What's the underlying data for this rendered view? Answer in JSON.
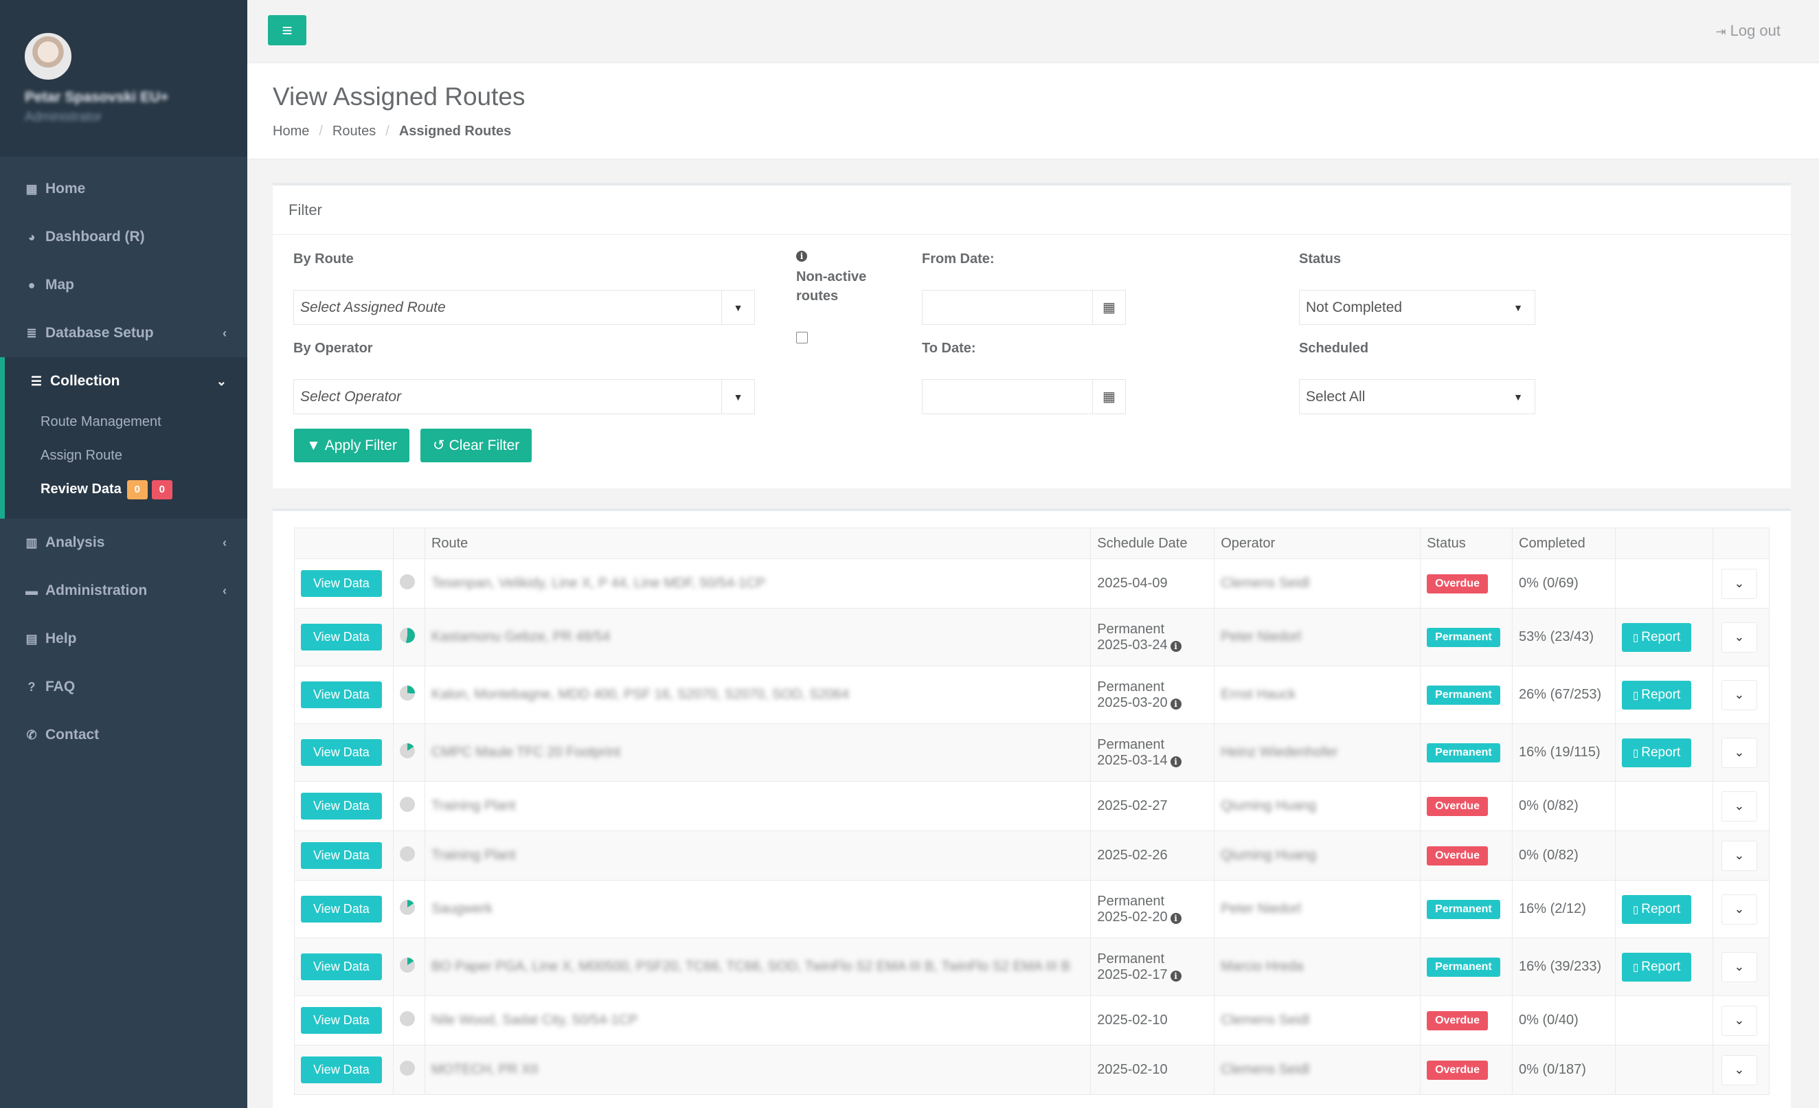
{
  "profile": {
    "name": "Petar Spasovski EU+",
    "role": "Administrator"
  },
  "nav": {
    "home": "Home",
    "dashboard": "Dashboard (R)",
    "map": "Map",
    "database_setup": "Database Setup",
    "collection": "Collection",
    "route_management": "Route Management",
    "assign_route": "Assign Route",
    "review_data": "Review Data",
    "review_badge_warn": "0",
    "review_badge_danger": "0",
    "analysis": "Analysis",
    "administration": "Administration",
    "help": "Help",
    "faq": "FAQ",
    "contact": "Contact"
  },
  "topbar": {
    "logout": "Log out"
  },
  "page": {
    "title": "View Assigned Routes",
    "breadcrumb": [
      "Home",
      "Routes",
      "Assigned Routes"
    ]
  },
  "filter": {
    "title": "Filter",
    "by_route_label": "By Route",
    "route_placeholder": "Select Assigned Route",
    "by_operator_label": "By Operator",
    "operator_placeholder": "Select Operator",
    "nonactive_label_1": "Non-active",
    "nonactive_label_2": "routes",
    "from_date_label": "From Date:",
    "to_date_label": "To Date:",
    "status_label": "Status",
    "status_value": "Not Completed",
    "scheduled_label": "Scheduled",
    "scheduled_value": "Select All",
    "apply": "Apply Filter",
    "clear": "Clear Filter"
  },
  "table": {
    "headers": [
      "",
      "",
      "Route",
      "Schedule Date",
      "Operator",
      "Status",
      "Completed",
      "",
      ""
    ],
    "view_label": "View Data",
    "report_label": "Report",
    "rows": [
      {
        "route": "Tesenpan, Velikidy, Line X, P 44, Line MDF, 50/54-1CP",
        "sched1": "",
        "sched2": "2025-04-09",
        "info": false,
        "operator": "Clemens Seidl",
        "status": "Overdue",
        "completed": "0% (0/69)",
        "report": false,
        "pct": 0
      },
      {
        "route": "Kastamonu Gebze, PR 48/54",
        "sched1": "Permanent",
        "sched2": "2025-03-24",
        "info": true,
        "operator": "Peter Niedorl",
        "status": "Permanent",
        "completed": "53% (23/43)",
        "report": true,
        "pct": 53
      },
      {
        "route": "Kalon, Montebagne, MDD 400, PSF 16, S2070, S2070, SOD, S2064",
        "sched1": "Permanent",
        "sched2": "2025-03-20",
        "info": true,
        "operator": "Ernst Hauck",
        "status": "Permanent",
        "completed": "26% (67/253)",
        "report": true,
        "pct": 26
      },
      {
        "route": "CMPC Maule TFC 20 Footprint",
        "sched1": "Permanent",
        "sched2": "2025-03-14",
        "info": true,
        "operator": "Heinz Wiedenhofer",
        "status": "Permanent",
        "completed": "16% (19/115)",
        "report": true,
        "pct": 16
      },
      {
        "route": "Training Plant",
        "sched1": "",
        "sched2": "2025-02-27",
        "info": false,
        "operator": "Qiuming Huang",
        "status": "Overdue",
        "completed": "0% (0/82)",
        "report": false,
        "pct": 0
      },
      {
        "route": "Training Plant",
        "sched1": "",
        "sched2": "2025-02-26",
        "info": false,
        "operator": "Qiuming Huang",
        "status": "Overdue",
        "completed": "0% (0/82)",
        "report": false,
        "pct": 0
      },
      {
        "route": "Saugwerk",
        "sched1": "Permanent",
        "sched2": "2025-02-20",
        "info": true,
        "operator": "Peter Niedorl",
        "status": "Permanent",
        "completed": "16% (2/12)",
        "report": true,
        "pct": 16
      },
      {
        "route": "BO Paper PGA, Line X, M00500, PSF20, TC66, TC66, SOD, TwinFlo S2 EMA III B, TwinFlo S2 EMA III B",
        "sched1": "Permanent",
        "sched2": "2025-02-17",
        "info": true,
        "operator": "Marcio Hreda",
        "status": "Permanent",
        "completed": "16% (39/233)",
        "report": true,
        "pct": 16
      },
      {
        "route": "Nile Wood, Sadat City, 50/54-1CP",
        "sched1": "",
        "sched2": "2025-02-10",
        "info": false,
        "operator": "Clemens Seidl",
        "status": "Overdue",
        "completed": "0% (0/40)",
        "report": false,
        "pct": 0
      },
      {
        "route": "MOTECH, PR XII",
        "sched1": "",
        "sched2": "2025-02-10",
        "info": false,
        "operator": "Clemens Seidl",
        "status": "Overdue",
        "completed": "0% (0/187)",
        "report": false,
        "pct": 0
      }
    ]
  },
  "colors": {
    "accent": "#1ab394",
    "info": "#23c6c8",
    "danger": "#ed5565",
    "warning": "#f8ac59",
    "sidebar": "#2f4050"
  },
  "icons": {
    "menu": "hamburger-icon",
    "logout": "sign-out-icon",
    "calendar": "calendar-icon",
    "filter": "filter-icon",
    "refresh": "refresh-icon",
    "report": "file-icon",
    "toggle": "chevron-down-icon"
  }
}
